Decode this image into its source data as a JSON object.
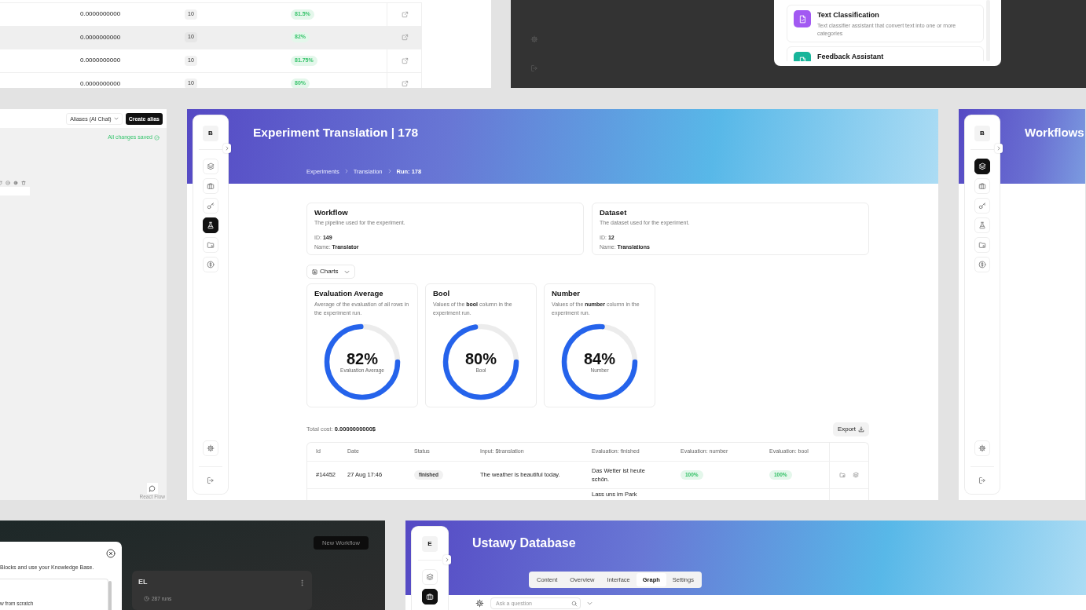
{
  "runs_table": {
    "rows": [
      {
        "cost": "0.0000000000",
        "count": "10",
        "score": "81.5%",
        "highlighted": false
      },
      {
        "cost": "0.0000000000",
        "count": "10",
        "score": "82%",
        "highlighted": true
      },
      {
        "cost": "0.0000000000",
        "count": "10",
        "score": "81.75%",
        "highlighted": false
      },
      {
        "cost": "0.0000000000",
        "count": "10",
        "score": "80%",
        "highlighted": false
      }
    ]
  },
  "assistant_window": {
    "templates": [
      {
        "title": "Text Classification",
        "description": "Text classifier assistant that convert text into one or more categories",
        "color": "#a259f2"
      },
      {
        "title": "Feedback Assistant",
        "color": "#17b59a"
      }
    ]
  },
  "flow_editor": {
    "alias_select": "Aliases (AI Chat)",
    "create_button": "Create alias",
    "save_status": "All changes saved",
    "attribution": "React Flow"
  },
  "experiment_window": {
    "sidebar": {
      "avatar": "B",
      "items": [
        {
          "selected": false
        },
        {
          "selected": false
        },
        {
          "selected": false
        },
        {
          "selected": true
        },
        {
          "selected": false
        },
        {
          "selected": false
        }
      ]
    },
    "title": "Experiment Translation | 178",
    "breadcrumbs": [
      "Experiments",
      "Translation",
      "Run: 178"
    ],
    "info_cards": [
      {
        "title": "Workflow",
        "description": "The pipeline used for the experiment.",
        "fields": [
          "ID: **149**",
          "Name: **Translator**"
        ]
      },
      {
        "title": "Dataset",
        "description": "The dataset used for the experiment.",
        "fields": [
          "ID: **12**",
          "Name: **Translations**"
        ]
      }
    ],
    "charts_menu": "Charts",
    "gauges": [
      {
        "title": "Evaluation Average",
        "description": "Average of the evaluation of all rows in the experiment run.",
        "level": 0.82,
        "reading": "82%",
        "caption": "Evaluation Average"
      },
      {
        "title": "Bool",
        "description": "Values of the **bool** column in the experiment run.",
        "level": 0.8,
        "reading": "80%",
        "caption": "Bool"
      },
      {
        "title": "Number",
        "description": "Values of the **number** column in the experiment run.",
        "level": 0.84,
        "reading": "84%",
        "caption": "Number"
      }
    ],
    "total_cost": "Total cost: **0.0000000000$**",
    "export_button": "Export",
    "table": {
      "columns": [
        "Id",
        "Date",
        "Status",
        "Input: $translation",
        "Evaluation: finished",
        "Evaluation: number",
        "Evaluation: bool"
      ],
      "rows": [
        {
          "id": "#14452",
          "date": "27 Aug 17:46",
          "status": "finished",
          "input": "The weather is beautiful today.",
          "finished": "Das Wetter ist heute schön.",
          "number": "100%",
          "bool": "100%"
        },
        {
          "finished": "Lass uns im Park"
        }
      ]
    }
  },
  "workflows_window": {
    "sidebar": {
      "avatar": "B",
      "items": [
        {
          "selected": true
        },
        {
          "selected": false
        },
        {
          "selected": false
        },
        {
          "selected": false
        },
        {
          "selected": false
        },
        {
          "selected": false
        }
      ]
    },
    "title": "Workflows"
  },
  "new_workflow_window": {
    "dialog": {
      "text": "Blocks and use your Knowledge Base.",
      "option": "w from scratch"
    },
    "new_button": "New Workflow",
    "workflow_card": {
      "title": "EL",
      "runs": "287 runs"
    }
  },
  "database_window": {
    "sidebar": {
      "avatar": "E",
      "items": [
        {
          "selected": false
        },
        {
          "selected": true
        }
      ]
    },
    "title": "Ustawy Database",
    "tabs": [
      {
        "label": "Content",
        "selected": false
      },
      {
        "label": "Overview",
        "selected": false
      },
      {
        "label": "Interface",
        "selected": false
      },
      {
        "label": "Graph",
        "selected": true
      },
      {
        "label": "Settings",
        "selected": false
      }
    ],
    "search": {
      "placeholder": "Ask a question"
    }
  }
}
